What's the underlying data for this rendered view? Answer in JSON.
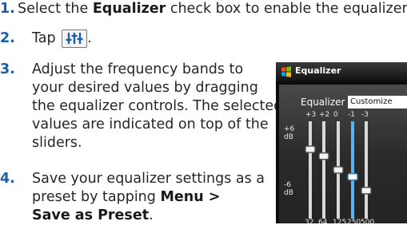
{
  "steps": [
    {
      "number": "1.",
      "parts": [
        "Select the ",
        "Equalizer",
        " check box to enable the equalizer."
      ]
    },
    {
      "number": "2.",
      "parts": [
        "Tap ",
        "."
      ]
    },
    {
      "number": "3.",
      "lines": [
        "Adjust the frequency bands to",
        "your desired values by dragging",
        "the equalizer controls. The selected",
        "values are indicated on top of the",
        "sliders."
      ]
    },
    {
      "number": "4.",
      "lines": [
        "Save your equalizer settings as a",
        "preset by tapping "
      ],
      "bold": [
        "Menu >",
        "Save as Preset"
      ],
      "tail": "."
    }
  ],
  "inline_icon": "equalizer-sliders-icon",
  "screenshot": {
    "title": "Equalizer",
    "title_icon": "windows-flag-icon",
    "equalizer_label": "Equalizer",
    "preset_value": "Customize",
    "db_top": [
      "+6",
      "dB"
    ],
    "db_bottom": [
      "-6",
      "dB"
    ],
    "band_values": [
      "+3",
      "+2",
      "0",
      "-1",
      "-3"
    ],
    "frequencies": [
      "32",
      "64",
      "125",
      "250",
      "500"
    ],
    "slider_levels": [
      3,
      2,
      0,
      -1,
      -3
    ],
    "selected_band": 3
  },
  "colors": {
    "step_number": "#1b5fa8",
    "selected_slider": "#5fb3ea"
  }
}
